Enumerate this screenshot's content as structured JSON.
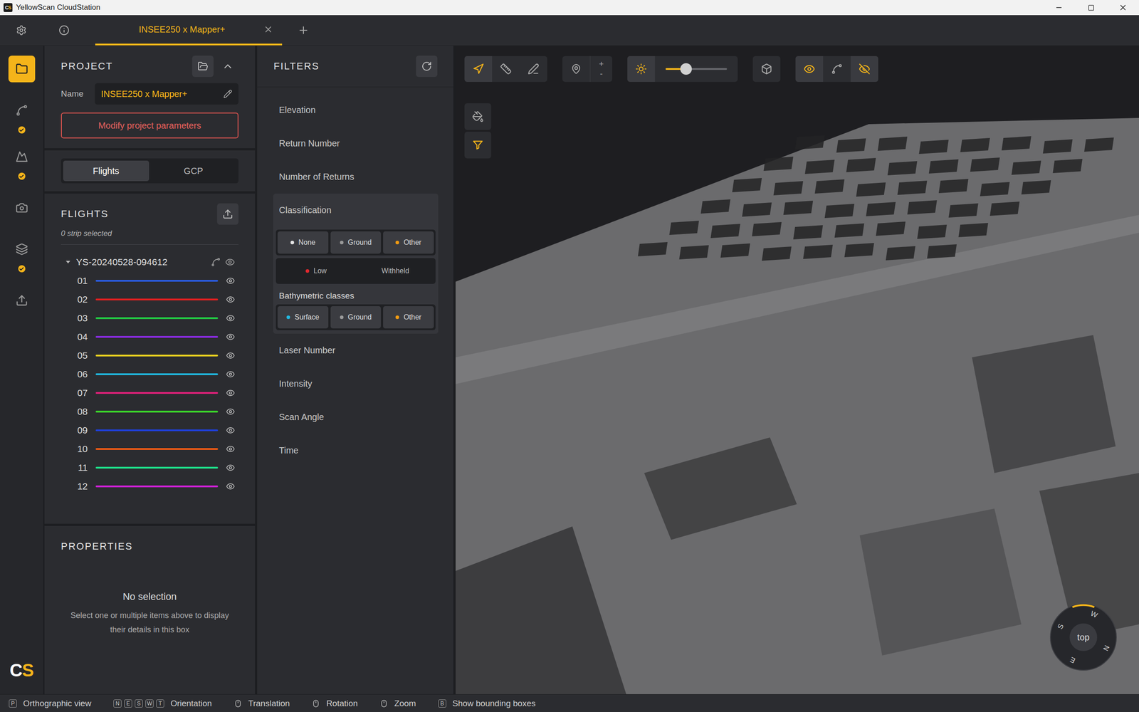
{
  "window": {
    "title": "YellowScan CloudStation"
  },
  "logo": [
    {
      "text": "C",
      "color": "#ffffff"
    },
    {
      "text": "S",
      "color": "#f4b41a"
    }
  ],
  "tabs": [
    {
      "label": "INSEE250 x Mapper+",
      "selected": true
    }
  ],
  "rail": [
    {
      "kind": "project",
      "selected": true,
      "checked": false
    },
    {
      "kind": "trajectory",
      "selected": false,
      "checked": true
    },
    {
      "kind": "surface",
      "selected": false,
      "checked": true
    },
    {
      "kind": "camera",
      "selected": false,
      "checked": false
    },
    {
      "kind": "classification",
      "selected": false,
      "checked": true
    },
    {
      "kind": "export",
      "selected": false,
      "checked": false
    }
  ],
  "project": {
    "title": "PROJECT",
    "name_label": "Name",
    "name": "INSEE250 x Mapper+",
    "modify_button": "Modify project parameters",
    "views": [
      {
        "label": "Flights",
        "selected": true
      },
      {
        "label": "GCP",
        "selected": false
      }
    ]
  },
  "flights": {
    "title": "FLIGHTS",
    "selection": "0 strip selected",
    "groups": [
      {
        "name": "YS-20240528-094612",
        "expanded": true,
        "visible": true,
        "strips": [
          {
            "label": "01",
            "color": "#2a5be0",
            "visible": true
          },
          {
            "label": "02",
            "color": "#e02020",
            "visible": true
          },
          {
            "label": "03",
            "color": "#22cc44",
            "visible": true
          },
          {
            "label": "04",
            "color": "#8a2be2",
            "visible": true
          },
          {
            "label": "05",
            "color": "#e8d020",
            "visible": true
          },
          {
            "label": "06",
            "color": "#20b8e0",
            "visible": true
          },
          {
            "label": "07",
            "color": "#e0207a",
            "visible": true
          },
          {
            "label": "08",
            "color": "#3bd62a",
            "visible": true
          },
          {
            "label": "09",
            "color": "#1e3fd8",
            "visible": true
          },
          {
            "label": "10",
            "color": "#f05a14",
            "visible": true
          },
          {
            "label": "11",
            "color": "#1ee08a",
            "visible": true
          },
          {
            "label": "12",
            "color": "#d020d8",
            "visible": true
          }
        ]
      }
    ]
  },
  "properties": {
    "title": "PROPERTIES",
    "heading": "No selection",
    "hint": "Select one or multiple items above to display their details in this box"
  },
  "filters": {
    "title": "FILTERS",
    "items": [
      {
        "label": "Elevation",
        "expanded": false
      },
      {
        "label": "Return Number",
        "expanded": false
      },
      {
        "label": "Number of Returns",
        "expanded": false
      },
      {
        "label": "Classification",
        "expanded": true,
        "class_rows": [
          [
            {
              "label": "None",
              "color": "#e6e6e6",
              "selected": true
            },
            {
              "label": "Ground",
              "color": "#9a9a9a",
              "selected": true
            },
            {
              "label": "Other",
              "color": "#f39c12",
              "selected": true
            }
          ],
          [
            {
              "label": "Low",
              "color": "#e0282e",
              "selected": false
            },
            {
              "label": "Withheld",
              "selected": false
            }
          ]
        ],
        "bathymetric": {
          "title": "Bathymetric classes",
          "classes": [
            {
              "label": "Surface",
              "color": "#22b8e0",
              "selected": true
            },
            {
              "label": "Ground",
              "color": "#9a9a9a",
              "selected": true
            },
            {
              "label": "Other",
              "color": "#f39c12",
              "selected": true
            }
          ]
        }
      },
      {
        "label": "Laser Number",
        "expanded": false
      },
      {
        "label": "Intensity",
        "expanded": false
      },
      {
        "label": "Scan Angle",
        "expanded": false
      },
      {
        "label": "Time",
        "expanded": false
      }
    ]
  },
  "viewport": {
    "tools": [
      {
        "kind": "navigate",
        "selected": true
      },
      {
        "kind": "measure",
        "selected": false
      },
      {
        "kind": "draw",
        "selected": false
      }
    ],
    "point_size": {
      "increase": "+",
      "decrease": "-"
    },
    "lighting": {
      "on": true,
      "level": 0.33
    },
    "perspective": {
      "selected": false
    },
    "display": [
      {
        "kind": "visibility",
        "selected": true
      },
      {
        "kind": "trajectory",
        "selected": false
      },
      {
        "kind": "hidden",
        "selected": true
      }
    ],
    "side_tools": [
      {
        "kind": "paint",
        "selected": false
      },
      {
        "kind": "filter",
        "selected": true
      }
    ],
    "compass": {
      "view": "top",
      "rotation_deg": 25,
      "directions": [
        "W",
        "N",
        "E",
        "S"
      ]
    }
  },
  "status_bar": [
    {
      "kind": "key",
      "keys": [
        "P"
      ],
      "label": "Orthographic view"
    },
    {
      "kind": "key",
      "keys": [
        "N",
        "E",
        "S",
        "W",
        "T"
      ],
      "label": "Orientation"
    },
    {
      "kind": "mouse",
      "label": "Translation"
    },
    {
      "kind": "mouse",
      "label": "Rotation"
    },
    {
      "kind": "mouse",
      "label": "Zoom"
    },
    {
      "kind": "key",
      "keys": [
        "B"
      ],
      "label": "Show bounding boxes"
    }
  ]
}
